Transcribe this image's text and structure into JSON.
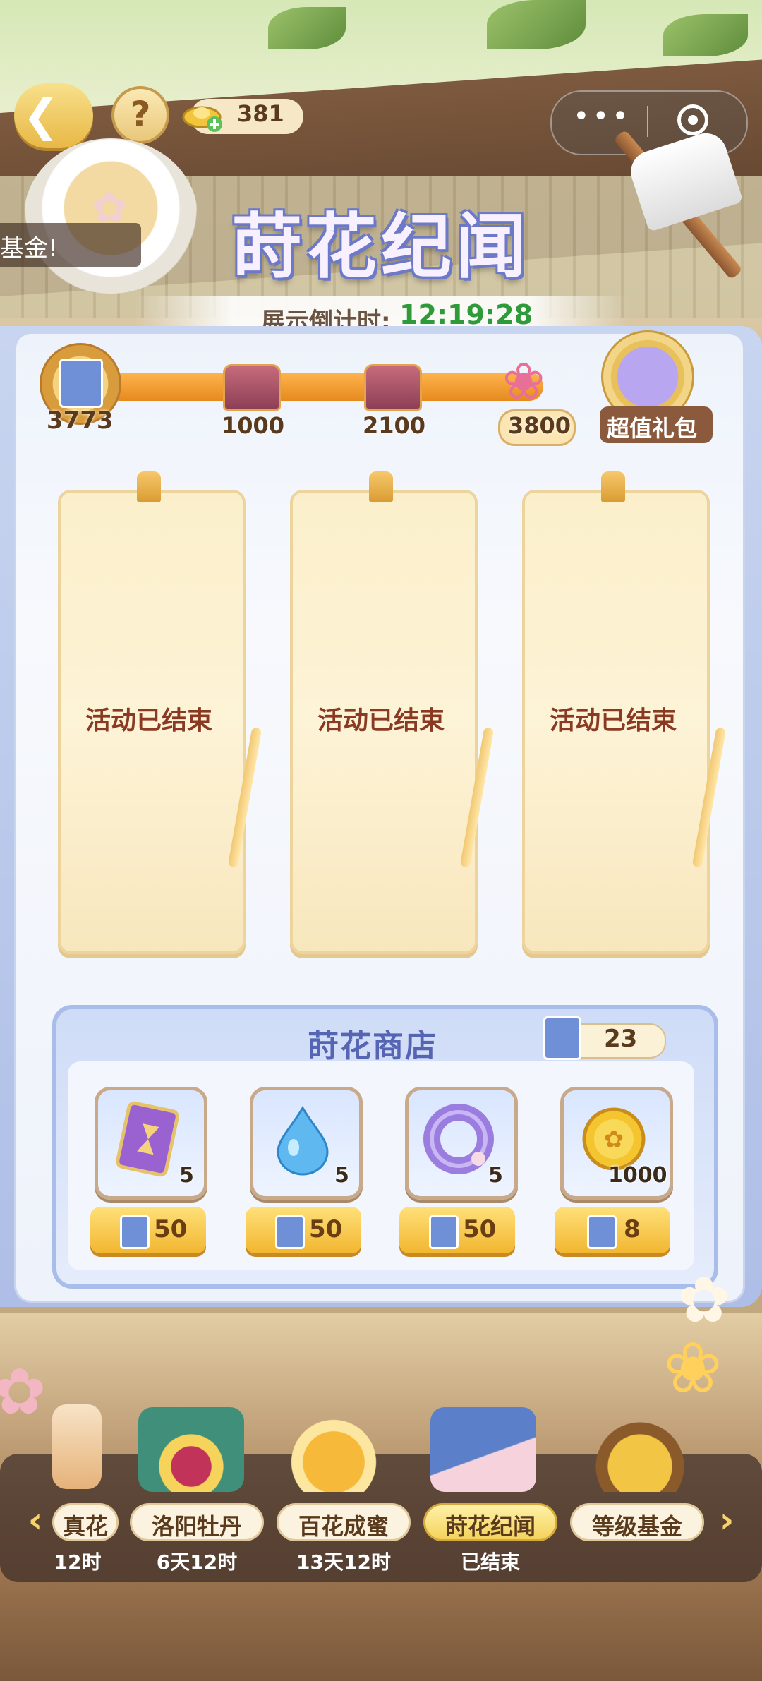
{
  "header": {
    "coins": "381",
    "help_icon": "?",
    "ticker_text": "基金!",
    "title": "莳花纪闻"
  },
  "countdown": {
    "label": "展示倒计时:",
    "value": "12:19:28"
  },
  "progress": {
    "current": "3773",
    "fill_fraction": 1.0,
    "milestones": [
      {
        "value": "1000",
        "icon": "treasure-chest-icon"
      },
      {
        "value": "2100",
        "icon": "treasure-chest-icon"
      },
      {
        "value": "3800",
        "icon": "flower-pot-icon"
      }
    ],
    "gift_label": "超值礼包"
  },
  "cards": [
    {
      "text": "活动已结束"
    },
    {
      "text": "活动已结束"
    },
    {
      "text": "活动已结束"
    }
  ],
  "shop": {
    "title": "莳花商店",
    "balance": "23",
    "items": [
      {
        "icon": "hourglass-card-icon",
        "qty": "5",
        "price": "50"
      },
      {
        "icon": "water-drop-icon",
        "qty": "5",
        "price": "50"
      },
      {
        "icon": "purple-ring-icon",
        "qty": "5",
        "price": "50"
      },
      {
        "icon": "gold-coin-icon",
        "qty": "1000",
        "price": "8"
      }
    ]
  },
  "nav": {
    "items": [
      {
        "label": "真花",
        "sub": "12时"
      },
      {
        "label": "洛阳牡丹",
        "sub": "6天12时"
      },
      {
        "label": "百花成蜜",
        "sub": "13天12时"
      },
      {
        "label": "莳花纪闻",
        "sub": "已结束",
        "active": true
      },
      {
        "label": "等级基金",
        "sub": ""
      }
    ]
  },
  "colors": {
    "countdown_green": "#2f9a3a",
    "card_text": "#8a3a22",
    "title_outline": "#6b79c7"
  }
}
